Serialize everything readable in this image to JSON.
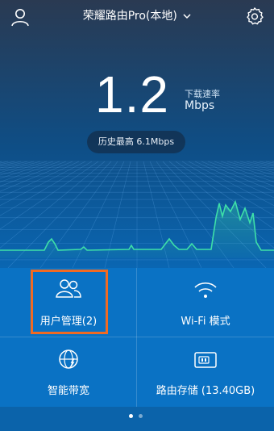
{
  "header": {
    "title": "荣耀路由Pro(本地)",
    "icons": [
      "user-icon",
      "chevron-down-icon",
      "gear-icon"
    ]
  },
  "speed": {
    "value": "1.2",
    "label": "下载速率",
    "unit": "Mbps",
    "peak": "历史最高 6.1Mbps"
  },
  "tiles": [
    {
      "label": "用户管理(2)",
      "icon": "users-icon"
    },
    {
      "label": "Wi-Fi 模式",
      "icon": "wifi-icon"
    },
    {
      "label": "智能带宽",
      "icon": "globe-icon"
    },
    {
      "label": "路由存储 (13.40GB)",
      "icon": "storage-icon"
    }
  ],
  "pager": {
    "count": 2,
    "active": 0
  },
  "colors": {
    "accent_line": "#3ee0a8",
    "tile_bg": "#0a72c4",
    "highlight": "#f06a23"
  }
}
